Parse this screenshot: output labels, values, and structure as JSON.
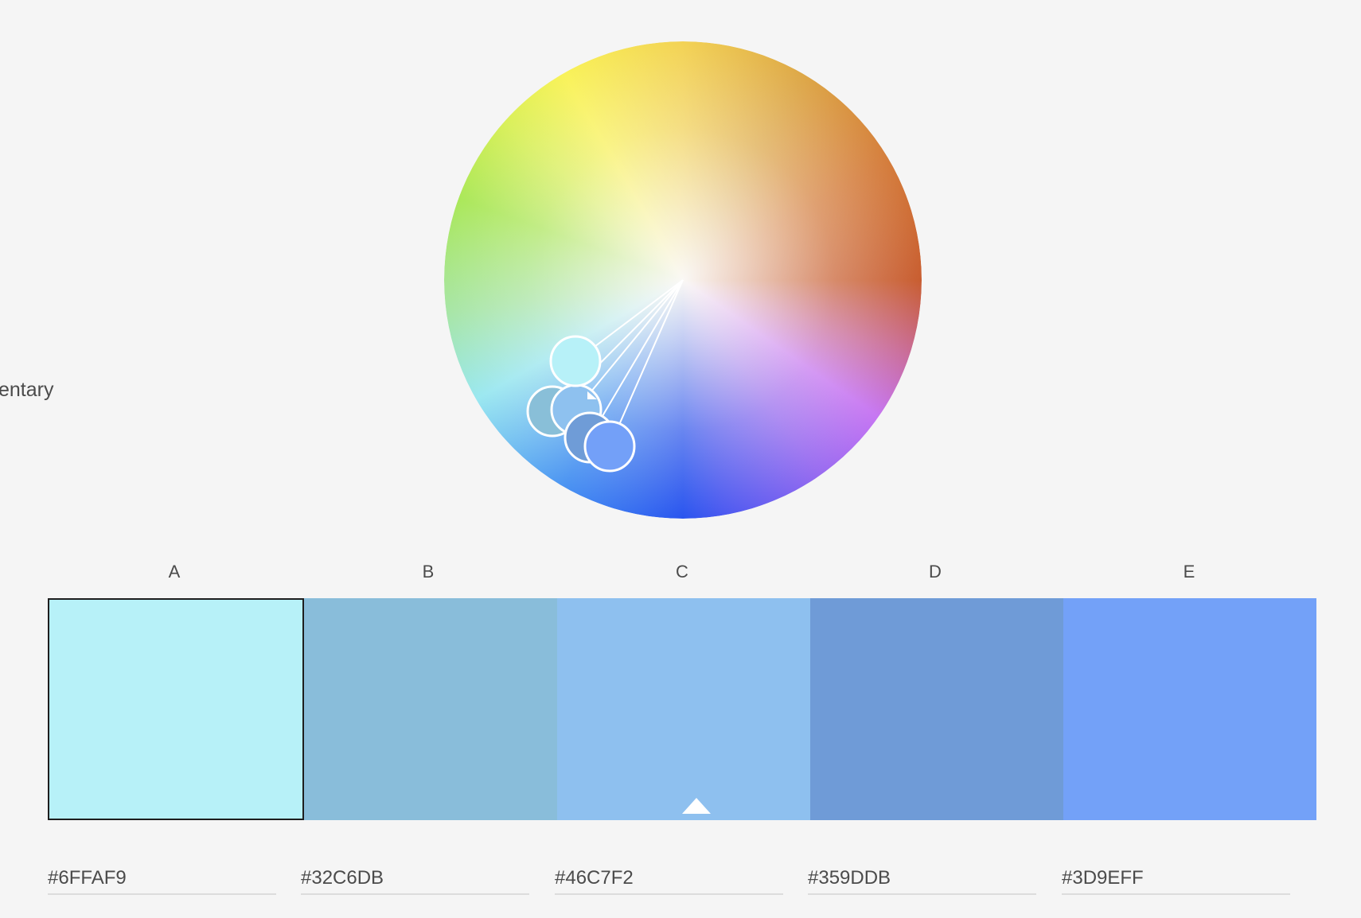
{
  "harmony_rule": {
    "label": "entary"
  },
  "wheel": {
    "handles": [
      {
        "name": "handle-a",
        "color": "#b7f1f8",
        "base": true
      },
      {
        "name": "handle-b",
        "color": "#89bfd8"
      },
      {
        "name": "handle-c",
        "color": "#8ec1ef"
      },
      {
        "name": "handle-d",
        "color": "#6f9cd7"
      },
      {
        "name": "handle-e",
        "color": "#73a0f8"
      }
    ]
  },
  "swatches": [
    {
      "label": "A",
      "color": "#b7f1f8",
      "hex": "#6FFAF9",
      "selected": true
    },
    {
      "label": "B",
      "color": "#89bdda",
      "hex": "#32C6DB"
    },
    {
      "label": "C",
      "color": "#8ec0ef",
      "hex": "#46C7F2",
      "base": true
    },
    {
      "label": "D",
      "color": "#6f9bd7",
      "hex": "#359DDB"
    },
    {
      "label": "E",
      "color": "#73a1f8",
      "hex": "#3D9EFF"
    }
  ]
}
